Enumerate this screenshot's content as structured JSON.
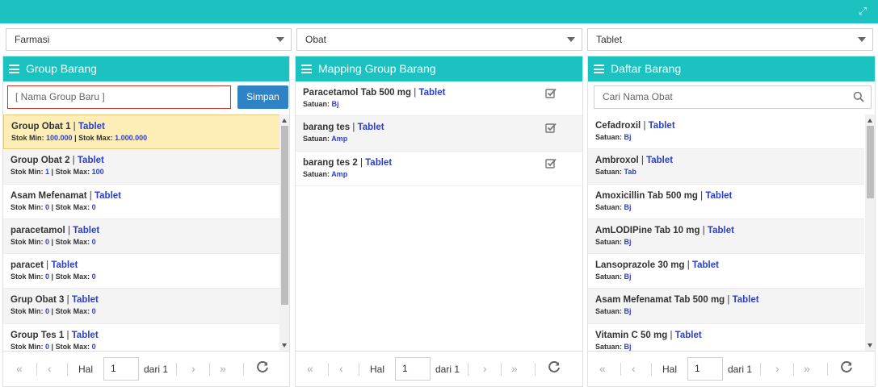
{
  "filters": {
    "category": "Farmasi",
    "type": "Obat",
    "form": "Tablet"
  },
  "group_panel": {
    "title": "Group Barang",
    "new_placeholder": "[ Nama Group Baru ]",
    "save_label": "Simpan",
    "items": [
      {
        "name": "Group Obat 1",
        "unit": "Tablet",
        "min_label": "Stok Min:",
        "min": "100.000",
        "max_label": "Stok Max:",
        "max": "1.000.000"
      },
      {
        "name": "Group Obat 2",
        "unit": "Tablet",
        "min_label": "Stok Min:",
        "min": "1",
        "max_label": "Stok Max:",
        "max": "100"
      },
      {
        "name": "Asam Mefenamat",
        "unit": "Tablet",
        "min_label": "Stok Min:",
        "min": "0",
        "max_label": "Stok Max:",
        "max": "0"
      },
      {
        "name": "paracetamol",
        "unit": "Tablet",
        "min_label": "Stok Min:",
        "min": "0",
        "max_label": "Stok Max:",
        "max": "0"
      },
      {
        "name": "paracet",
        "unit": "Tablet",
        "min_label": "Stok Min:",
        "min": "0",
        "max_label": "Stok Max:",
        "max": "0"
      },
      {
        "name": "Grup Obat 3",
        "unit": "Tablet",
        "min_label": "Stok Min:",
        "min": "0",
        "max_label": "Stok Max:",
        "max": "0"
      },
      {
        "name": "Group Tes 1",
        "unit": "Tablet",
        "min_label": "Stok Min:",
        "min": "0",
        "max_label": "Stok Max:",
        "max": "0"
      }
    ]
  },
  "mapping_panel": {
    "title": "Mapping Group Barang",
    "items": [
      {
        "name": "Paracetamol Tab 500 mg",
        "unit": "Tablet",
        "satuan_label": "Satuan:",
        "satuan": "Bj"
      },
      {
        "name": "barang tes",
        "unit": "Tablet",
        "satuan_label": "Satuan:",
        "satuan": "Amp"
      },
      {
        "name": "barang tes 2",
        "unit": "Tablet",
        "satuan_label": "Satuan:",
        "satuan": "Amp"
      }
    ]
  },
  "daftar_panel": {
    "title": "Daftar Barang",
    "search_placeholder": "Cari Nama Obat",
    "items": [
      {
        "name": "Cefadroxil",
        "unit": "Tablet",
        "satuan_label": "Satuan:",
        "satuan": "Bj"
      },
      {
        "name": "Ambroxol",
        "unit": "Tablet",
        "satuan_label": "Satuan:",
        "satuan": "Tab"
      },
      {
        "name": "Amoxicillin Tab 500 mg",
        "unit": "Tablet",
        "satuan_label": "Satuan:",
        "satuan": "Bj"
      },
      {
        "name": "AmLODIPine Tab 10 mg",
        "unit": "Tablet",
        "satuan_label": "Satuan:",
        "satuan": "Bj"
      },
      {
        "name": "Lansoprazole 30 mg",
        "unit": "Tablet",
        "satuan_label": "Satuan:",
        "satuan": "Bj"
      },
      {
        "name": "Asam Mefenamat Tab 500 mg",
        "unit": "Tablet",
        "satuan_label": "Satuan:",
        "satuan": "Bj"
      },
      {
        "name": "Vitamin C 50 mg",
        "unit": "Tablet",
        "satuan_label": "Satuan:",
        "satuan": "Bj"
      }
    ]
  },
  "pager": {
    "hal_label": "Hal",
    "page": "1",
    "of_label": "dari 1"
  },
  "colors": {
    "accent": "#1cc2c0",
    "button": "#2f83c5",
    "unit_text": "#2a3fcf",
    "selected_row": "#fdeeb8"
  },
  "icons": {
    "expand": "expand-icon",
    "list": "list-icon",
    "check": "checkbox-checked-icon",
    "search": "search-icon",
    "first": "first-page-icon",
    "prev": "prev-page-icon",
    "next": "next-page-icon",
    "last": "last-page-icon",
    "refresh": "refresh-icon"
  }
}
